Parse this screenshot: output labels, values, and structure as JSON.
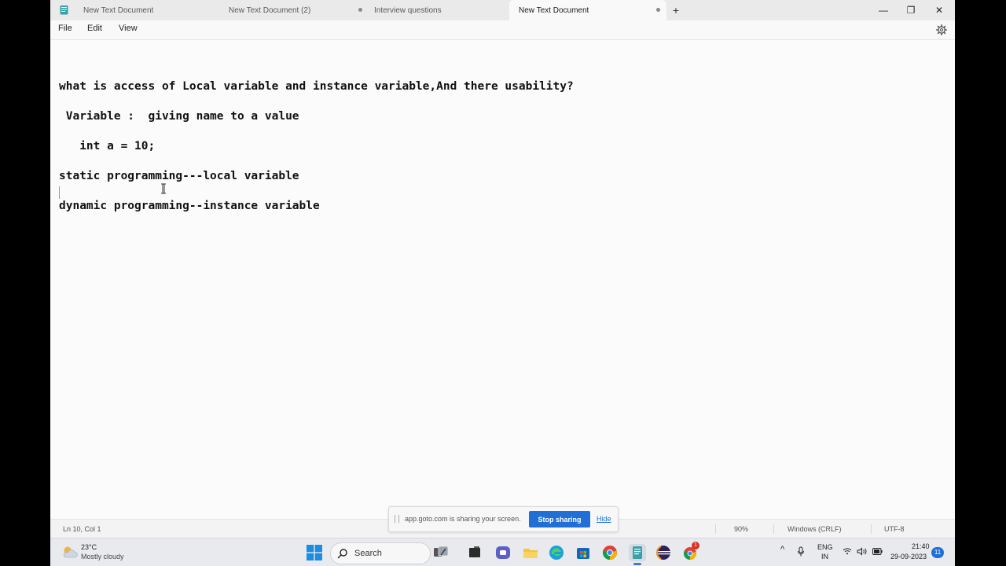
{
  "tabs": [
    {
      "label": "New Text Document",
      "unsaved": false,
      "active": false
    },
    {
      "label": "New Text Document (2)",
      "unsaved": true,
      "active": false
    },
    {
      "label": "Interview questions",
      "unsaved": false,
      "active": false
    },
    {
      "label": "New Text Document",
      "unsaved": true,
      "active": true
    }
  ],
  "window_controls": {
    "minimize": "—",
    "maximize": "❐",
    "close": "✕",
    "new_tab": "+"
  },
  "menu": {
    "file": "File",
    "edit": "Edit",
    "view": "View"
  },
  "document": {
    "lines": [
      "what is access of Local variable and instance variable,And there usability?",
      " Variable :  giving name to a value",
      "   int a = 10;",
      "static programming---local variable",
      "",
      "dynamic programming--instance variable"
    ]
  },
  "status": {
    "position": "Ln 10, Col 1",
    "zoom": "90%",
    "line_ending": "Windows (CRLF)",
    "encoding": "UTF-8"
  },
  "share_banner": {
    "message": "app.goto.com is sharing your screen.",
    "stop_label": "Stop sharing",
    "hide_label": "Hide"
  },
  "taskbar": {
    "temperature": "23°C",
    "condition": "Mostly cloudy",
    "search_label": "Search",
    "language_line1": "ENG",
    "language_line2": "IN",
    "time": "21:40",
    "date": "29-09-2023",
    "notification_count": "11",
    "chrome_badge": "1"
  },
  "colors": {
    "accent": "#1f6fd6",
    "editor_bg": "#fbfbfb",
    "chrome_bg": "#eaeaea"
  }
}
